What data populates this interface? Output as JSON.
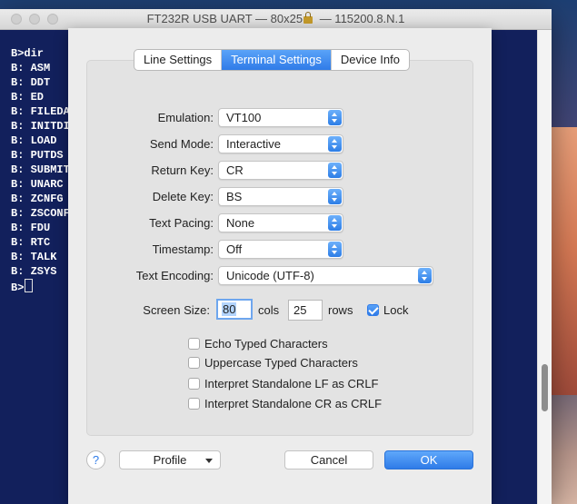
{
  "window": {
    "title_prefix": "FT232R USB UART — 80x25",
    "title_suffix": " — 115200.8.N.1"
  },
  "terminal": {
    "lines": [
      "B>dir",
      "B: ASM",
      "B: DDT",
      "B: ED",
      "B: FILEDA",
      "B: INITDI",
      "B: LOAD",
      "B: PUTDS",
      "B: SUBMIT",
      "B: UNARC",
      "B: ZCNFG",
      "B: ZSCONF",
      "B: FDU",
      "B: RTC",
      "B: TALK",
      "B: ZSYS"
    ],
    "prompt": "B>"
  },
  "tabs": [
    {
      "label": "Line Settings",
      "active": false
    },
    {
      "label": "Terminal Settings",
      "active": true
    },
    {
      "label": "Device Info",
      "active": false
    }
  ],
  "settings": {
    "emulation": {
      "label": "Emulation:",
      "value": "VT100"
    },
    "send_mode": {
      "label": "Send Mode:",
      "value": "Interactive"
    },
    "return_key": {
      "label": "Return Key:",
      "value": "CR"
    },
    "delete_key": {
      "label": "Delete Key:",
      "value": "BS"
    },
    "text_pacing": {
      "label": "Text Pacing:",
      "value": "None"
    },
    "timestamp": {
      "label": "Timestamp:",
      "value": "Off"
    },
    "text_encoding": {
      "label": "Text Encoding:",
      "value": "Unicode (UTF-8)"
    }
  },
  "screen_size": {
    "label": "Screen Size:",
    "cols_value": "80",
    "cols_label": "cols",
    "rows_value": "25",
    "rows_label": "rows",
    "lock_label": "Lock",
    "lock_checked": true
  },
  "options": [
    {
      "label": "Echo Typed Characters",
      "checked": false
    },
    {
      "label": "Uppercase Typed Characters",
      "checked": false
    },
    {
      "label": "Interpret Standalone LF as CRLF",
      "checked": false
    },
    {
      "label": "Interpret Standalone CR as CRLF",
      "checked": false
    }
  ],
  "buttons": {
    "help": "?",
    "profile": "Profile",
    "cancel": "Cancel",
    "ok": "OK"
  },
  "colors": {
    "terminal_bg": "#12205c",
    "accent": "#2f7be8"
  }
}
